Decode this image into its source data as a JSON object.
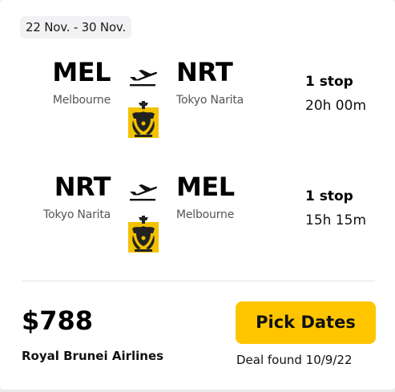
{
  "dates": "22 Nov. - 30 Nov.",
  "legs": [
    {
      "origin_code": "MEL",
      "origin_city": "Melbourne",
      "dest_code": "NRT",
      "dest_city": "Tokyo Narita",
      "stops": "1 stop",
      "duration": "20h 00m",
      "plane_icon": "plane-takeoff-icon",
      "airline_logo": "royal-brunei-logo"
    },
    {
      "origin_code": "NRT",
      "origin_city": "Tokyo Narita",
      "dest_code": "MEL",
      "dest_city": "Melbourne",
      "stops": "1 stop",
      "duration": "15h 15m",
      "plane_icon": "plane-takeoff-icon",
      "airline_logo": "royal-brunei-logo"
    }
  ],
  "price": "$788",
  "airline": "Royal Brunei Airlines",
  "cta_label": "Pick Dates",
  "deal_found": "Deal found 10/9/22",
  "colors": {
    "cta": "#ffc600",
    "logo_gold": "#f2c200",
    "text": "#111111",
    "muted": "#555555"
  }
}
